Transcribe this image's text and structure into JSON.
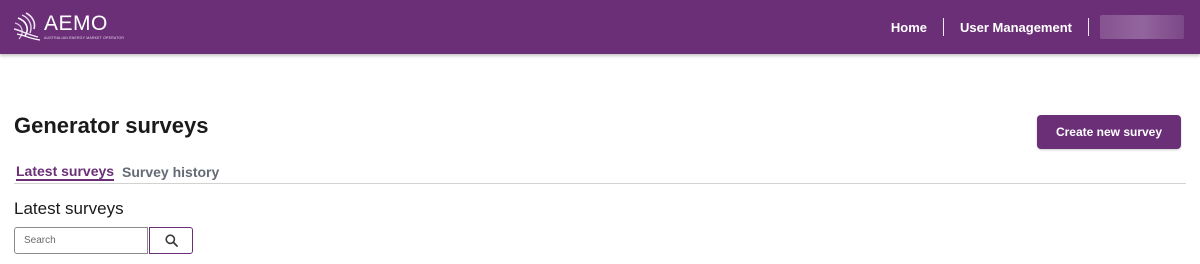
{
  "header": {
    "logo": {
      "wordmark": "AEMO",
      "tagline": "AUSTRALIAN ENERGY MARKET OPERATOR"
    },
    "nav": [
      {
        "label": "Home"
      },
      {
        "label": "User Management"
      }
    ],
    "user_menu": {
      "state": "redacted"
    }
  },
  "main": {
    "title": "Generator surveys",
    "create_button": "Create new survey",
    "tabs": [
      {
        "label": "Latest surveys",
        "active": true
      },
      {
        "label": "Survey history",
        "active": false
      }
    ],
    "section_title": "Latest surveys",
    "search": {
      "placeholder": "Search",
      "value": ""
    }
  },
  "colors": {
    "brand": "#6b2f78",
    "tab_inactive": "#636b75",
    "text": "#1a1a1a"
  },
  "icons": {
    "logo_mark": "aemo-swirl-icon",
    "search": "search-icon"
  }
}
